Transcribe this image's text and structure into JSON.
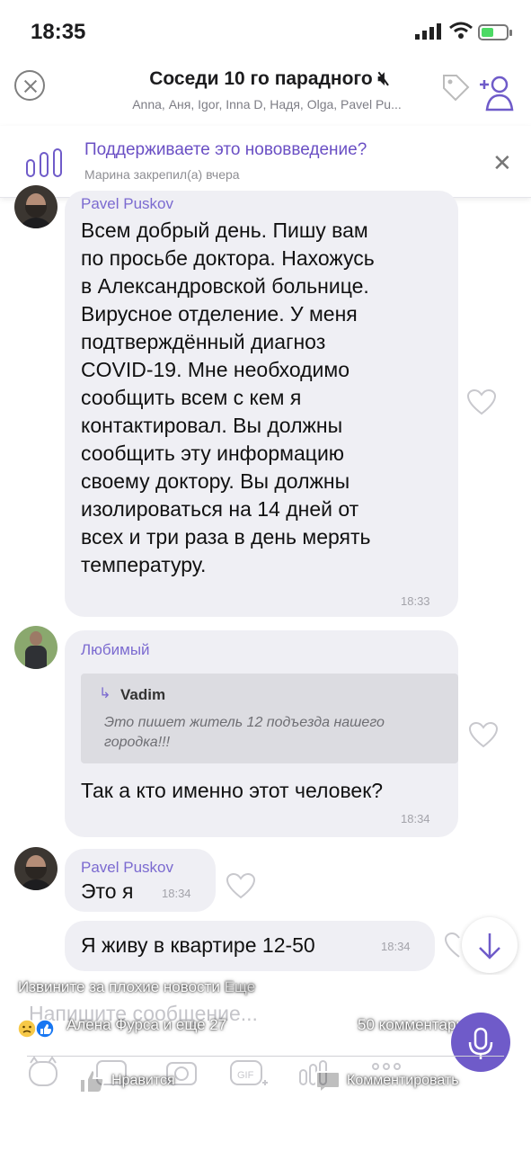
{
  "status_bar": {
    "time": "18:35"
  },
  "header": {
    "title": "Соседи 10 го парадного",
    "members": "Anna, Аня, Igor, Inna D, Надя, Olga, Pavel Pu..."
  },
  "pinned": {
    "title": "Поддерживаете это нововведение?",
    "subtitle": "Марина закрепил(а) вчера"
  },
  "messages": [
    {
      "sender": "Pavel Puskov",
      "lines": [
        "Всем добрый день. Пишу вам",
        "по просьбе доктора. Нахожусь",
        "в Александровской больнице.",
        "Вирусное отделение. У меня",
        "подтверждённый диагноз",
        "COVID-19. Мне необходимо",
        "сообщить всем с кем я",
        "контактировал. Вы должны",
        "сообщить эту информацию",
        "своему доктору. Вы должны",
        "изолироваться на 14 дней от",
        "всех и три раза в день мерять",
        "температуру."
      ],
      "time": "18:33"
    },
    {
      "sender": "Любимый",
      "reply": {
        "name": "Vadim",
        "text": "Это пишет житель 12 подъезда нашего городка!!!"
      },
      "text": "Так а кто именно этот человек?",
      "time": "18:34"
    },
    {
      "sender": "Pavel Puskov",
      "text": "Это я",
      "time": "18:34"
    },
    {
      "text": "Я живу в квартире 12-50",
      "time": "18:34"
    }
  ],
  "composer": {
    "placeholder": "Напишите сообщение..."
  },
  "facebook_overlay": {
    "caption": "Извините за плохие новости",
    "caption_more": "Еще",
    "reactors": "Алена Фурса и еще 27",
    "comments": "50 комментариев",
    "like_label": "Нравится",
    "comment_label": "Комментировать"
  },
  "colors": {
    "accent": "#6f5bc9",
    "sender": "#7b6ad0",
    "bubble": "#efeff4"
  }
}
